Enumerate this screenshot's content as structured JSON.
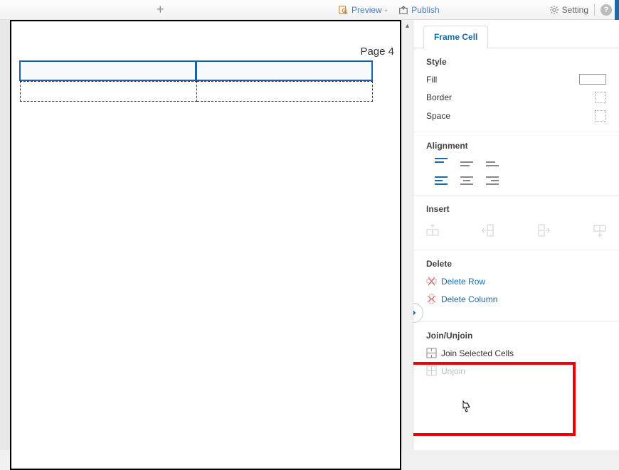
{
  "topbar": {
    "preview_label": "Preview",
    "publish_label": "Publish",
    "setting_label": "Setting"
  },
  "canvas": {
    "page_label": "Page 4"
  },
  "sidebar": {
    "tab_label": "Frame Cell",
    "style": {
      "heading": "Style",
      "fill_label": "Fill",
      "border_label": "Border",
      "space_label": "Space"
    },
    "alignment": {
      "heading": "Alignment"
    },
    "insert": {
      "heading": "Insert"
    },
    "delete": {
      "heading": "Delete",
      "row_label": "Delete Row",
      "column_label": "Delete Column"
    },
    "join": {
      "heading": "Join/Unjoin",
      "join_label": "Join Selected Cells",
      "unjoin_label": "Unjoin"
    }
  }
}
